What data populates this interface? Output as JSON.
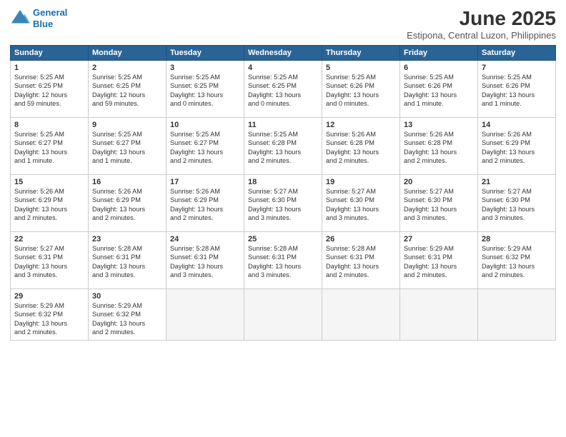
{
  "header": {
    "logo_line1": "General",
    "logo_line2": "Blue",
    "month": "June 2025",
    "location": "Estipona, Central Luzon, Philippines"
  },
  "weekdays": [
    "Sunday",
    "Monday",
    "Tuesday",
    "Wednesday",
    "Thursday",
    "Friday",
    "Saturday"
  ],
  "weeks": [
    [
      {
        "day": "1",
        "info": "Sunrise: 5:25 AM\nSunset: 6:25 PM\nDaylight: 12 hours\nand 59 minutes."
      },
      {
        "day": "2",
        "info": "Sunrise: 5:25 AM\nSunset: 6:25 PM\nDaylight: 12 hours\nand 59 minutes."
      },
      {
        "day": "3",
        "info": "Sunrise: 5:25 AM\nSunset: 6:25 PM\nDaylight: 13 hours\nand 0 minutes."
      },
      {
        "day": "4",
        "info": "Sunrise: 5:25 AM\nSunset: 6:25 PM\nDaylight: 13 hours\nand 0 minutes."
      },
      {
        "day": "5",
        "info": "Sunrise: 5:25 AM\nSunset: 6:26 PM\nDaylight: 13 hours\nand 0 minutes."
      },
      {
        "day": "6",
        "info": "Sunrise: 5:25 AM\nSunset: 6:26 PM\nDaylight: 13 hours\nand 1 minute."
      },
      {
        "day": "7",
        "info": "Sunrise: 5:25 AM\nSunset: 6:26 PM\nDaylight: 13 hours\nand 1 minute."
      }
    ],
    [
      {
        "day": "8",
        "info": "Sunrise: 5:25 AM\nSunset: 6:27 PM\nDaylight: 13 hours\nand 1 minute."
      },
      {
        "day": "9",
        "info": "Sunrise: 5:25 AM\nSunset: 6:27 PM\nDaylight: 13 hours\nand 1 minute."
      },
      {
        "day": "10",
        "info": "Sunrise: 5:25 AM\nSunset: 6:27 PM\nDaylight: 13 hours\nand 2 minutes."
      },
      {
        "day": "11",
        "info": "Sunrise: 5:25 AM\nSunset: 6:28 PM\nDaylight: 13 hours\nand 2 minutes."
      },
      {
        "day": "12",
        "info": "Sunrise: 5:26 AM\nSunset: 6:28 PM\nDaylight: 13 hours\nand 2 minutes."
      },
      {
        "day": "13",
        "info": "Sunrise: 5:26 AM\nSunset: 6:28 PM\nDaylight: 13 hours\nand 2 minutes."
      },
      {
        "day": "14",
        "info": "Sunrise: 5:26 AM\nSunset: 6:29 PM\nDaylight: 13 hours\nand 2 minutes."
      }
    ],
    [
      {
        "day": "15",
        "info": "Sunrise: 5:26 AM\nSunset: 6:29 PM\nDaylight: 13 hours\nand 2 minutes."
      },
      {
        "day": "16",
        "info": "Sunrise: 5:26 AM\nSunset: 6:29 PM\nDaylight: 13 hours\nand 2 minutes."
      },
      {
        "day": "17",
        "info": "Sunrise: 5:26 AM\nSunset: 6:29 PM\nDaylight: 13 hours\nand 2 minutes."
      },
      {
        "day": "18",
        "info": "Sunrise: 5:27 AM\nSunset: 6:30 PM\nDaylight: 13 hours\nand 3 minutes."
      },
      {
        "day": "19",
        "info": "Sunrise: 5:27 AM\nSunset: 6:30 PM\nDaylight: 13 hours\nand 3 minutes."
      },
      {
        "day": "20",
        "info": "Sunrise: 5:27 AM\nSunset: 6:30 PM\nDaylight: 13 hours\nand 3 minutes."
      },
      {
        "day": "21",
        "info": "Sunrise: 5:27 AM\nSunset: 6:30 PM\nDaylight: 13 hours\nand 3 minutes."
      }
    ],
    [
      {
        "day": "22",
        "info": "Sunrise: 5:27 AM\nSunset: 6:31 PM\nDaylight: 13 hours\nand 3 minutes."
      },
      {
        "day": "23",
        "info": "Sunrise: 5:28 AM\nSunset: 6:31 PM\nDaylight: 13 hours\nand 3 minutes."
      },
      {
        "day": "24",
        "info": "Sunrise: 5:28 AM\nSunset: 6:31 PM\nDaylight: 13 hours\nand 3 minutes."
      },
      {
        "day": "25",
        "info": "Sunrise: 5:28 AM\nSunset: 6:31 PM\nDaylight: 13 hours\nand 3 minutes."
      },
      {
        "day": "26",
        "info": "Sunrise: 5:28 AM\nSunset: 6:31 PM\nDaylight: 13 hours\nand 2 minutes."
      },
      {
        "day": "27",
        "info": "Sunrise: 5:29 AM\nSunset: 6:31 PM\nDaylight: 13 hours\nand 2 minutes."
      },
      {
        "day": "28",
        "info": "Sunrise: 5:29 AM\nSunset: 6:32 PM\nDaylight: 13 hours\nand 2 minutes."
      }
    ],
    [
      {
        "day": "29",
        "info": "Sunrise: 5:29 AM\nSunset: 6:32 PM\nDaylight: 13 hours\nand 2 minutes."
      },
      {
        "day": "30",
        "info": "Sunrise: 5:29 AM\nSunset: 6:32 PM\nDaylight: 13 hours\nand 2 minutes."
      },
      {
        "day": "",
        "info": ""
      },
      {
        "day": "",
        "info": ""
      },
      {
        "day": "",
        "info": ""
      },
      {
        "day": "",
        "info": ""
      },
      {
        "day": "",
        "info": ""
      }
    ]
  ]
}
